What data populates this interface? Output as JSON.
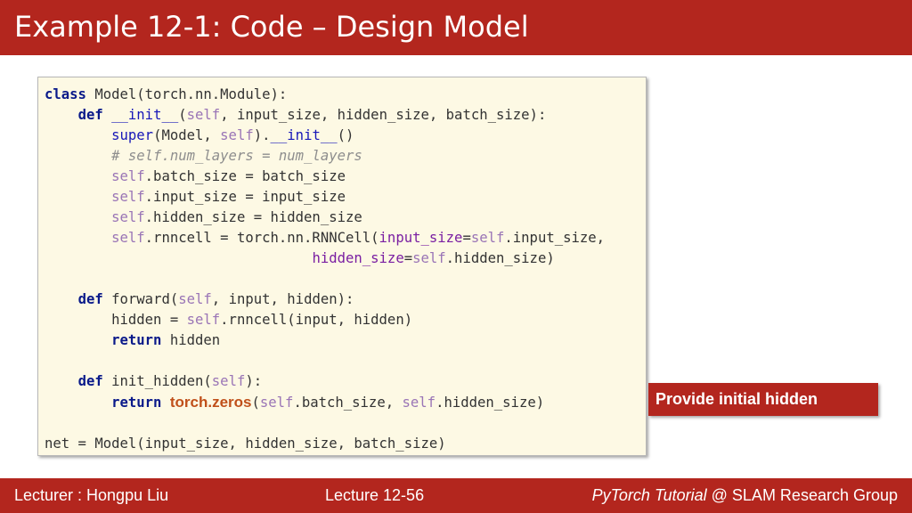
{
  "slide": {
    "title": "Example 12-1: Code – Design Model"
  },
  "code": {
    "l1_kw": "class",
    "l1_text": " Model(torch.nn.Module):",
    "l2_kw": "def",
    "l2_fn": "__init__",
    "l2_self": "self",
    "l2_text": ", input_size, hidden_size, batch_size):",
    "l3_fn": "super",
    "l3_text_a": "(Model, ",
    "l3_self": "self",
    "l3_text_b": ").",
    "l3_fn2": "__init__",
    "l3_text_c": "()",
    "l4_comment": "# self.num_layers = num_layers",
    "l5_self": "self",
    "l5_text": ".batch_size = batch_size",
    "l6_self": "self",
    "l6_text": ".input_size = input_size",
    "l7_self": "self",
    "l7_text": ".hidden_size = hidden_size",
    "l8_self": "self",
    "l8_text_a": ".rnncell = torch.nn.RNNCell(",
    "l8_kwarg": "input_size",
    "l8_eq": "=",
    "l8_self2": "self",
    "l8_text_b": ".input_size,",
    "l9_kwarg": "hidden_size",
    "l9_eq": "=",
    "l9_self": "self",
    "l9_text": ".hidden_size)",
    "l11_kw": "def",
    "l11_text_a": " forward(",
    "l11_self": "self",
    "l11_text_b": ", input, hidden):",
    "l12_text_a": "hidden = ",
    "l12_self": "self",
    "l12_text_b": ".rnncell(input, hidden)",
    "l13_kw": "return",
    "l13_text": " hidden",
    "l15_kw": "def",
    "l15_text_a": " init_hidden(",
    "l15_self": "self",
    "l15_text_b": "):",
    "l16_kw": "return",
    "l16_hl": "torch.zeros",
    "l16_text_a": "(",
    "l16_self": "self",
    "l16_text_b": ".batch_size, ",
    "l16_self2": "self",
    "l16_text_c": ".hidden_size)",
    "l18_text": "net = Model(input_size, hidden_size, batch_size)"
  },
  "callout": {
    "text": "Provide initial hidden"
  },
  "footer": {
    "lecturer": "Lecturer : Hongpu Liu",
    "lecture": "Lecture 12-56",
    "course": "PyTorch Tutorial",
    "group": " @ SLAM Research Group"
  },
  "colors": {
    "brand": "#b3261e",
    "code_background": "#fdf9e4",
    "keyword": "#0a1a8a",
    "self": "#9a75b6",
    "highlight": "#c0501a"
  }
}
